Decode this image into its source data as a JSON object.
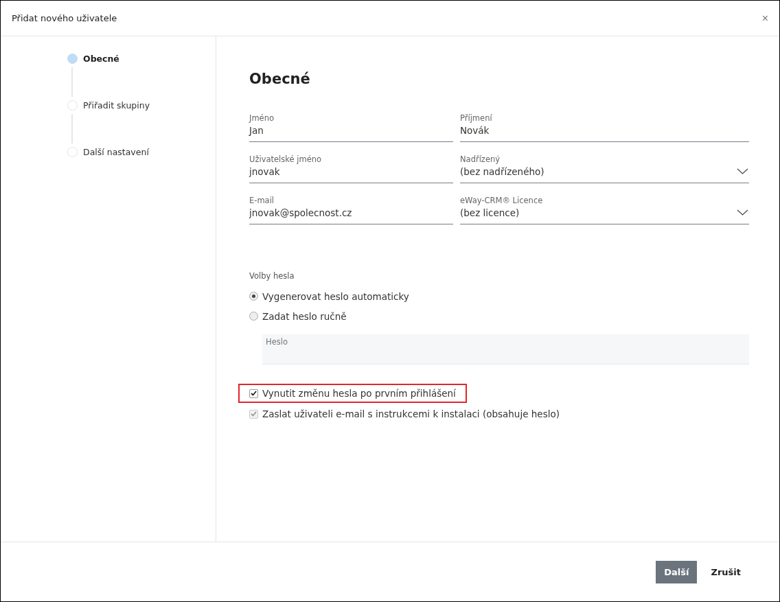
{
  "window": {
    "title": "Přidat nového uživatele",
    "close": "×"
  },
  "steps": [
    {
      "label": "Obecné",
      "selected": true
    },
    {
      "label": "Přiřadit skupiny",
      "selected": false
    },
    {
      "label": "Další nastavení",
      "selected": false
    }
  ],
  "heading": "Obecné",
  "fields": [
    {
      "kind": "text",
      "label": "Jméno",
      "value": "Jan"
    },
    {
      "kind": "text",
      "label": "Příjmení",
      "value": "Novák"
    },
    {
      "kind": "text",
      "label": "Uživatelské jméno",
      "value": "jnovak"
    },
    {
      "kind": "select",
      "label": "Nadřízený",
      "value": "(bez nadřízeného)"
    },
    {
      "kind": "text",
      "label": "E-mail",
      "value": "jnovak@spolecnost.cz"
    },
    {
      "kind": "select",
      "label": "eWay-CRM® Licence",
      "value": "(bez licence)"
    }
  ],
  "password_options": {
    "label": "Volby hesla",
    "options": [
      {
        "label": "Vygenerovat heslo automaticky",
        "selected": true
      },
      {
        "label": "Zadat heslo ručně",
        "selected": false
      }
    ]
  },
  "password_field": {
    "label": "Heslo",
    "disabled": true
  },
  "checkboxes": [
    {
      "label": "Vynutit změnu hesla po prvním přihlášení",
      "checked": true,
      "disabled": false,
      "highlighted": true
    },
    {
      "label": "Zaslat uživateli e-mail s instrukcemi k instalaci (obsahuje heslo)",
      "checked": true,
      "disabled": true,
      "highlighted": false
    }
  ],
  "buttons": [
    {
      "label": "Další",
      "kind": "primary"
    },
    {
      "label": "Zrušit",
      "kind": "secondary"
    }
  ]
}
